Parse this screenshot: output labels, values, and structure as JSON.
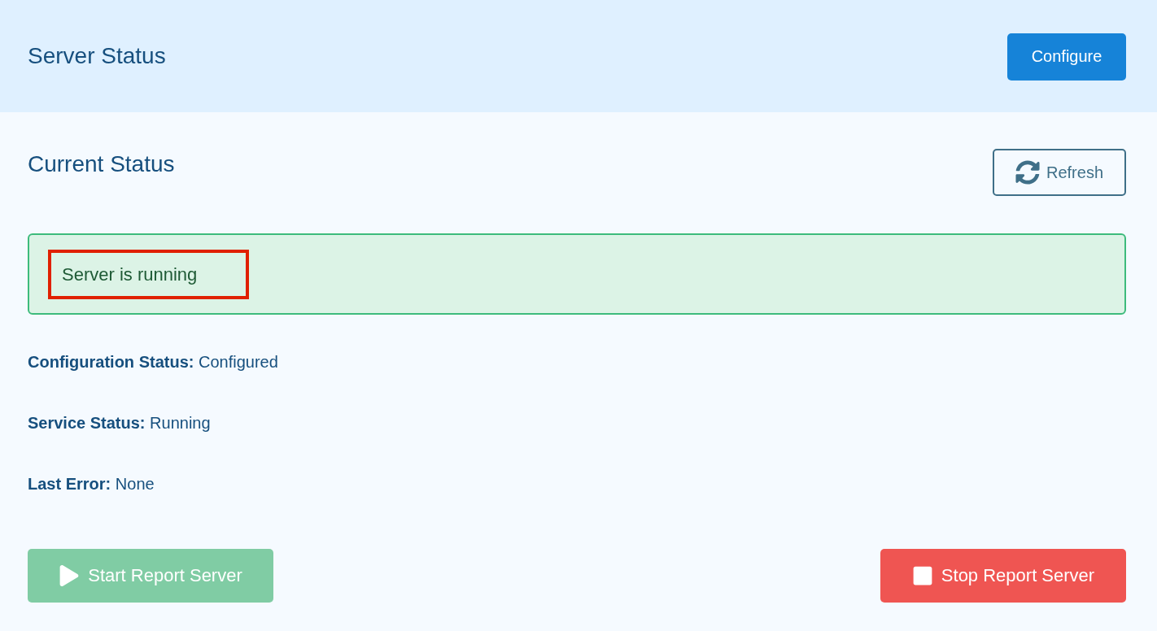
{
  "header": {
    "title": "Server Status",
    "configure_button": {
      "label": "Configure"
    }
  },
  "current_status": {
    "title": "Current Status",
    "refresh_button": {
      "label": "Refresh"
    },
    "status_alert": {
      "kind": "success",
      "message": "Server is running",
      "highlighted": true
    },
    "details": [
      {
        "label": "Configuration Status:",
        "value": "Configured"
      },
      {
        "label": "Service Status:",
        "value": "Running"
      },
      {
        "label": "Last Error:",
        "value": "None"
      }
    ],
    "actions": [
      {
        "kind": "start",
        "label": "Start Report Server",
        "disabled": true
      },
      {
        "kind": "stop",
        "label": "Stop Report Server",
        "disabled": false
      }
    ]
  }
}
